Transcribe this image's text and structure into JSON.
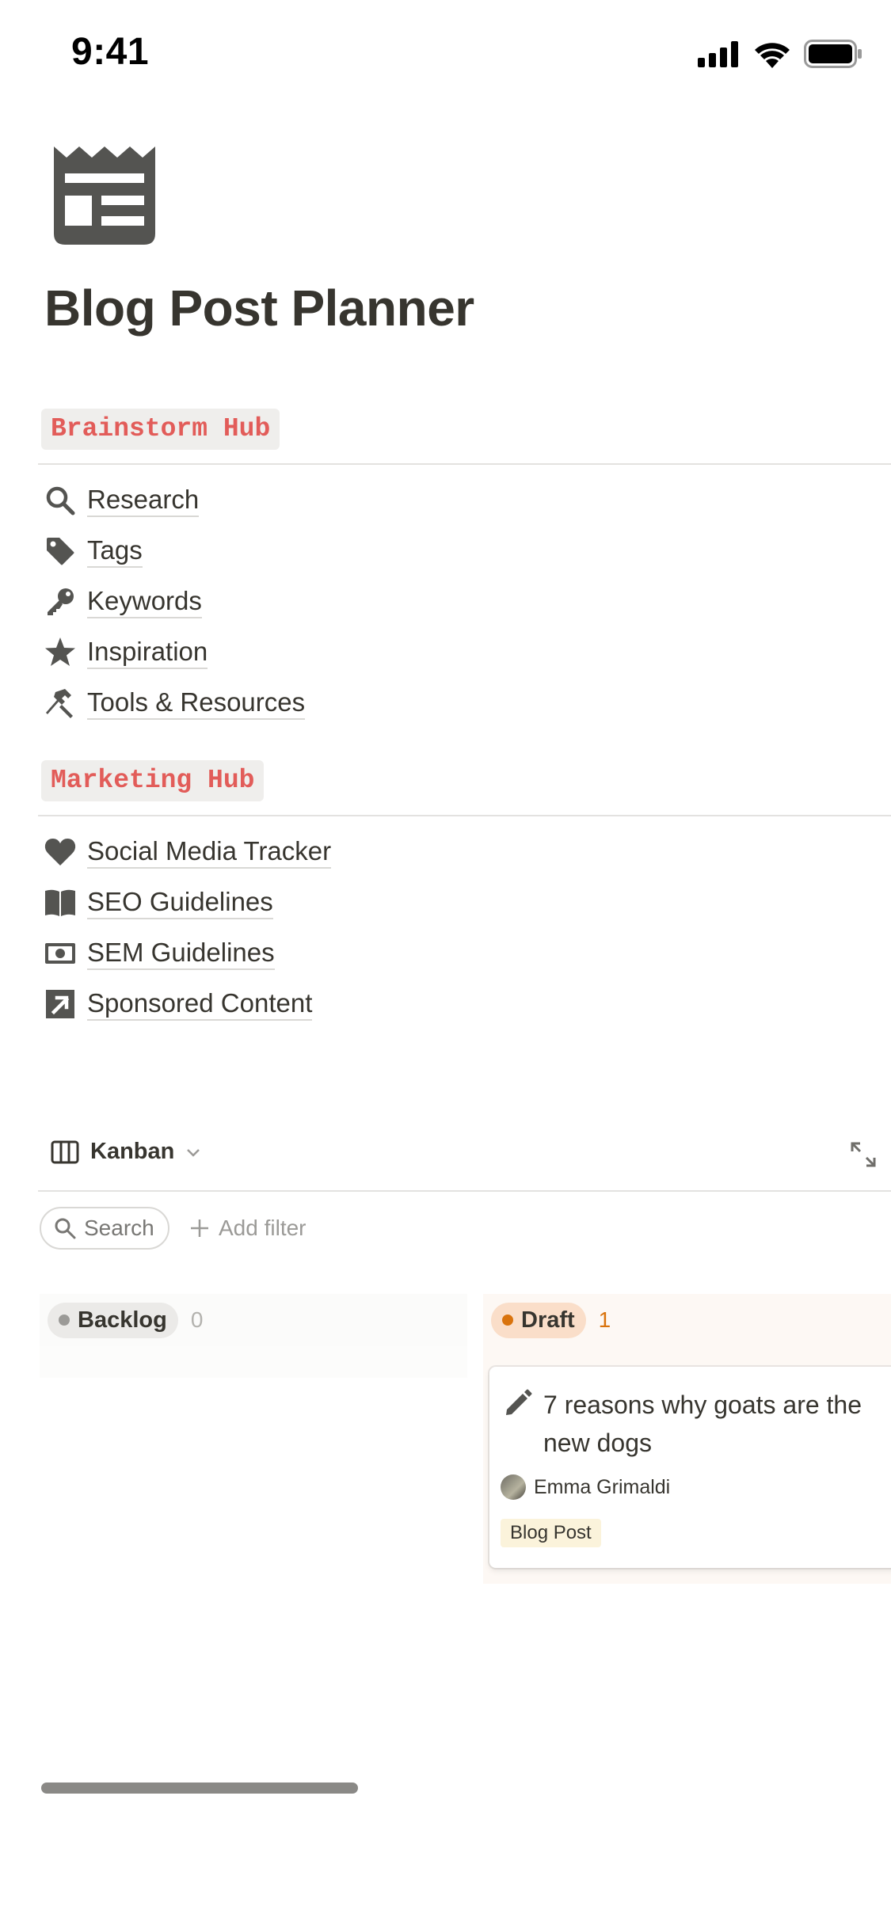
{
  "status_bar": {
    "time": "9:41"
  },
  "page": {
    "title": "Blog Post Planner",
    "icon": "newspaper-icon"
  },
  "sections": [
    {
      "label": "Brainstorm Hub",
      "items": [
        {
          "label": "Research",
          "icon": "search-icon"
        },
        {
          "label": "Tags",
          "icon": "tag-icon"
        },
        {
          "label": "Keywords",
          "icon": "key-icon"
        },
        {
          "label": "Inspiration",
          "icon": "star-icon"
        },
        {
          "label": "Tools & Resources",
          "icon": "hammer-icon"
        }
      ]
    },
    {
      "label": "Marketing Hub",
      "items": [
        {
          "label": "Social Media Tracker",
          "icon": "heart-icon"
        },
        {
          "label": "SEO Guidelines",
          "icon": "book-icon"
        },
        {
          "label": "SEM Guidelines",
          "icon": "money-icon"
        },
        {
          "label": "Sponsored Content",
          "icon": "arrow-up-right-icon"
        }
      ]
    }
  ],
  "database": {
    "view_label": "Kanban",
    "search_placeholder": "Search",
    "add_filter_label": "Add filter",
    "columns": [
      {
        "name": "Backlog",
        "count": "0",
        "color": "#9b9a97",
        "bg": "#ebeae8",
        "count_color": "#b3b2ae"
      },
      {
        "name": "Draft",
        "count": "1",
        "color": "#d9730d",
        "bg": "#fadec9",
        "count_color": "#d9730d"
      }
    ],
    "cards": [
      {
        "title": "7 reasons why goats are the new dogs",
        "author": "Emma Grimaldi",
        "tag": "Blog Post"
      }
    ]
  }
}
